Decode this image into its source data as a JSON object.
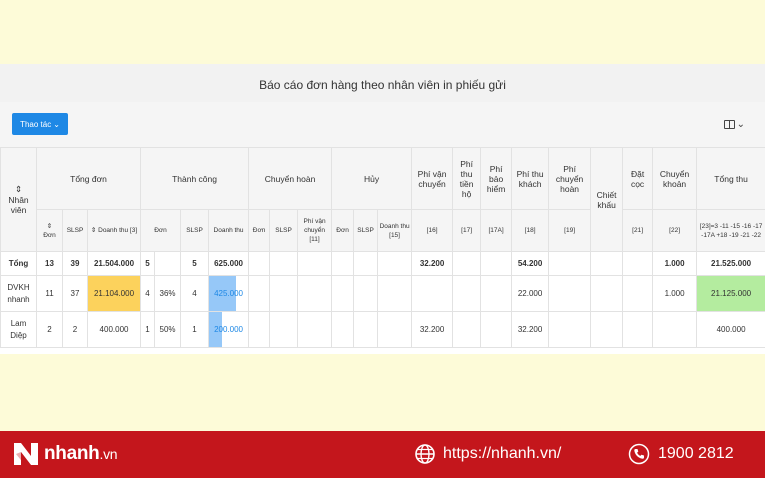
{
  "report": {
    "title": "Báo cáo đơn hàng theo nhân viên in phiếu gửi",
    "actions_label": "Thao tác",
    "actions_caret": "⌄",
    "columns_caret": "⌄"
  },
  "headers": {
    "employee": "Nhân viên",
    "sort_glyph": "⇕",
    "tong_don": "Tổng đơn",
    "thanh_cong": "Thành công",
    "chuyen_hoan": "Chuyển hoàn",
    "huy": "Hủy",
    "phi_van_chuyen": "Phí vận chuyển",
    "phi_thu_tien_ho": "Phí thu tiền hộ",
    "phi_bao_hiem": "Phí bảo hiểm",
    "phi_thu_khach": "Phí thu khách",
    "phi_chuyen_hoan": "Phí chuyển hoàn",
    "chiet_khau": "Chiết khấu",
    "dat_coc": "Đặt cọc",
    "chuyen_khoan": "Chuyển khoản",
    "tong_thu": "Tổng thu",
    "sub": {
      "don": "Đơn",
      "slsp": "SLSP",
      "doanh_thu_3": "Doanh thu [3]",
      "doanh_thu": "Doanh thu",
      "phi_vc_11": "Phí vận chuyển [11]",
      "doanh_thu_15": "Doanh thu [15]",
      "c16": "[16]",
      "c17": "[17]",
      "c17a": "[17A]",
      "c18": "[18]",
      "c19": "[19]",
      "c21": "[21]",
      "c22": "[22]",
      "formula": "[23]=3 -11 -15 -16 -17 -17A +18 -19 -21 -22"
    }
  },
  "rows": {
    "total": {
      "name": "Tổng",
      "don": "13",
      "slsp": "39",
      "doanh_thu": "21.504.000",
      "tc_don": "5",
      "tc_slsp": "5",
      "tc_doanh_thu": "625.000",
      "phi_van_chuyen": "32.200",
      "phi_thu_khach": "54.200",
      "chuyen_khoan": "1.000",
      "tong_thu": "21.525.000"
    },
    "r1": {
      "name": "DVKH nhanh",
      "don": "11",
      "slsp": "37",
      "doanh_thu": "21.104.000",
      "tc_don": "4",
      "tc_pct": "36%",
      "tc_slsp": "4",
      "tc_doanh_thu": "425.000",
      "tc_doanh_thu_share": 0.68,
      "phi_thu_khach": "22.000",
      "chuyen_khoan": "1.000",
      "tong_thu": "21.125.000"
    },
    "r2": {
      "name": "Lam Diệp",
      "don": "2",
      "slsp": "2",
      "doanh_thu": "400.000",
      "tc_don": "1",
      "tc_pct": "50%",
      "tc_slsp": "1",
      "tc_doanh_thu": "200.000",
      "tc_doanh_thu_share": 0.32,
      "phi_van_chuyen": "32.200",
      "phi_thu_khach": "32.200",
      "tong_thu": "400.000"
    }
  },
  "footer": {
    "brand": "nhanh",
    "brand_suffix": ".vn",
    "website": "https://nhanh.vn/",
    "hotline": "1900 2812"
  },
  "colors": {
    "footer_bg": "#c4161c",
    "page_bg": "#fdfbd8",
    "accent_blue": "#1e88e5",
    "highlight_yellow": "#fcd25c",
    "highlight_green": "#b4ec9f"
  }
}
